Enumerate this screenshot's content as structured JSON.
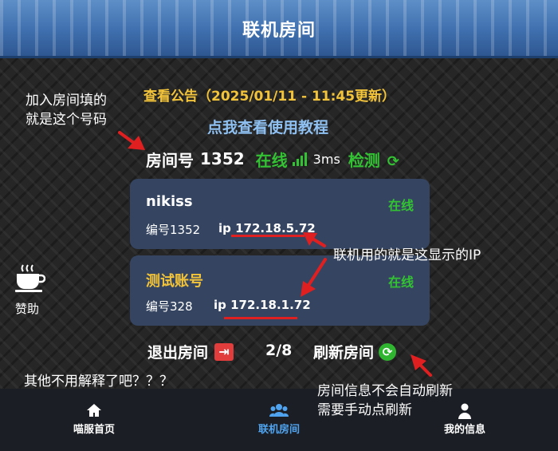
{
  "header": {
    "title": "联机房间"
  },
  "notice": "查看公告（2025/01/11 - 11:45更新）",
  "tutorial_link": "点我查看使用教程",
  "room": {
    "label": "房间号",
    "number": "1352",
    "status": "在线",
    "latency": "3ms",
    "check_label": "检测"
  },
  "players": [
    {
      "name": "nikiss",
      "status": "在线",
      "id_text": "编号1352",
      "ip_text": "ip 172.18.5.72",
      "name_color": "#ffffff"
    },
    {
      "name": "测试账号",
      "status": "在线",
      "id_text": "编号328",
      "ip_text": "ip 172.18.1.72",
      "name_color": "#f3c43a"
    }
  ],
  "actions": {
    "exit_label": "退出房间",
    "count": "2/8",
    "refresh_label": "刷新房间"
  },
  "sidebar": {
    "donate_label": "赞助",
    "donate_icon": "coffee-cup-icon"
  },
  "annotations": {
    "join_note_line1": "加入房间填的",
    "join_note_line2": "就是这个号码",
    "ip_note": "联机用的就是这显示的IP",
    "other_note": "其他不用解释了吧？？？",
    "refresh_note_line1": "房间信息不会自动刷新",
    "refresh_note_line2": "需要手动点刷新"
  },
  "bottom_nav": [
    {
      "label": "喵服首页",
      "icon": "home-icon",
      "active": false
    },
    {
      "label": "联机房间",
      "icon": "users-icon",
      "active": true
    },
    {
      "label": "我的信息",
      "icon": "user-icon",
      "active": false
    }
  ],
  "colors": {
    "accent_blue": "#4fa3ef",
    "online_green": "#33c233",
    "notice_yellow": "#f3c43a",
    "card_bg": "#354561",
    "annotation_red": "#e02020"
  }
}
